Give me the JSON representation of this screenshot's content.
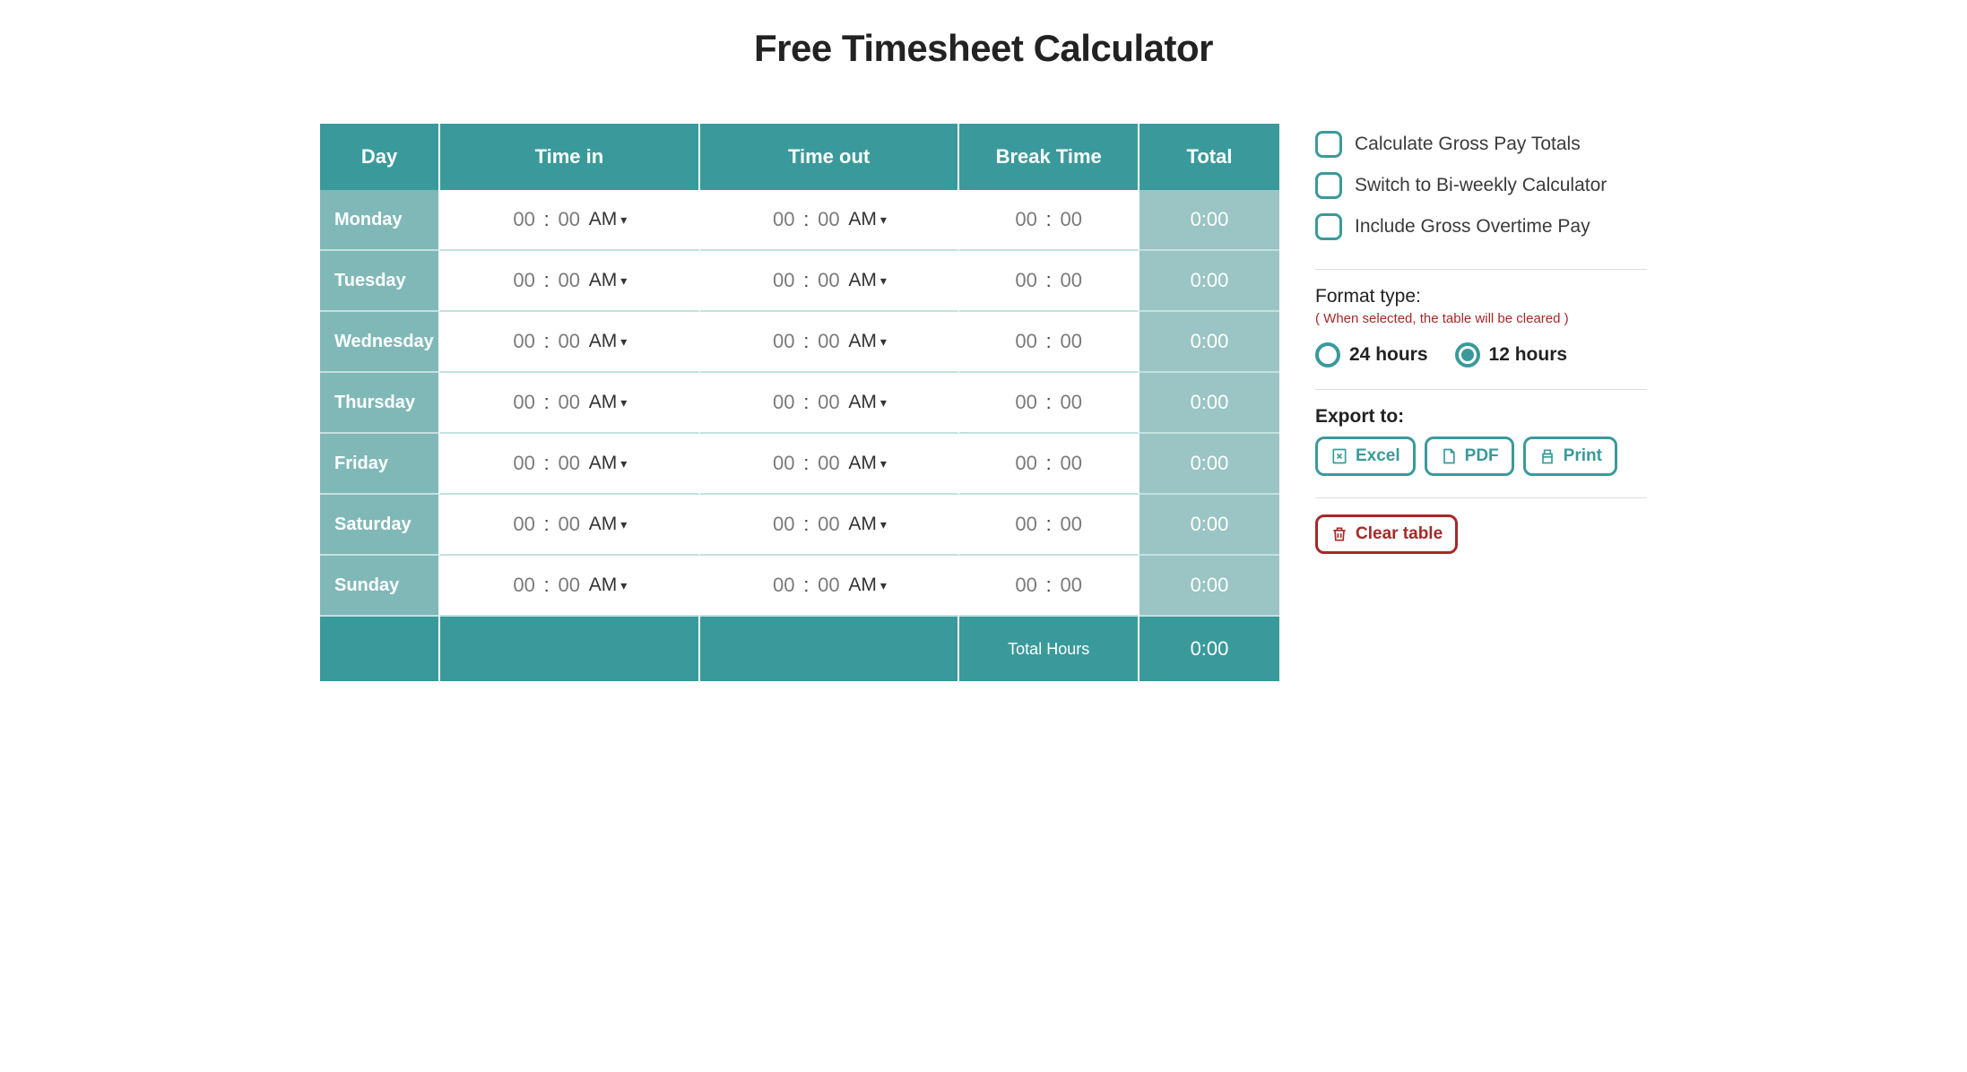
{
  "title": "Free Timesheet Calculator",
  "columns": [
    "Day",
    "Time in",
    "Time out",
    "Break Time",
    "Total"
  ],
  "days": [
    {
      "name": "Monday",
      "in_h": "00",
      "in_m": "00",
      "in_ap": "AM",
      "out_h": "00",
      "out_m": "00",
      "out_ap": "AM",
      "br_h": "00",
      "br_m": "00",
      "total": "0:00"
    },
    {
      "name": "Tuesday",
      "in_h": "00",
      "in_m": "00",
      "in_ap": "AM",
      "out_h": "00",
      "out_m": "00",
      "out_ap": "AM",
      "br_h": "00",
      "br_m": "00",
      "total": "0:00"
    },
    {
      "name": "Wednesday",
      "in_h": "00",
      "in_m": "00",
      "in_ap": "AM",
      "out_h": "00",
      "out_m": "00",
      "out_ap": "AM",
      "br_h": "00",
      "br_m": "00",
      "total": "0:00"
    },
    {
      "name": "Thursday",
      "in_h": "00",
      "in_m": "00",
      "in_ap": "AM",
      "out_h": "00",
      "out_m": "00",
      "out_ap": "AM",
      "br_h": "00",
      "br_m": "00",
      "total": "0:00"
    },
    {
      "name": "Friday",
      "in_h": "00",
      "in_m": "00",
      "in_ap": "AM",
      "out_h": "00",
      "out_m": "00",
      "out_ap": "AM",
      "br_h": "00",
      "br_m": "00",
      "total": "0:00"
    },
    {
      "name": "Saturday",
      "in_h": "00",
      "in_m": "00",
      "in_ap": "AM",
      "out_h": "00",
      "out_m": "00",
      "out_ap": "AM",
      "br_h": "00",
      "br_m": "00",
      "total": "0:00"
    },
    {
      "name": "Sunday",
      "in_h": "00",
      "in_m": "00",
      "in_ap": "AM",
      "out_h": "00",
      "out_m": "00",
      "out_ap": "AM",
      "br_h": "00",
      "br_m": "00",
      "total": "0:00"
    }
  ],
  "footer": {
    "label": "Total Hours",
    "value": "0:00"
  },
  "options": {
    "gross_pay": "Calculate Gross Pay Totals",
    "biweekly": "Switch to Bi-weekly Calculator",
    "overtime": "Include Gross Overtime Pay"
  },
  "format": {
    "title": "Format type:",
    "note": "( When selected, the table will be cleared )",
    "opt24": "24 hours",
    "opt12": "12 hours",
    "selected": "12"
  },
  "export": {
    "title": "Export to:",
    "excel": "Excel",
    "pdf": "PDF",
    "print": "Print"
  },
  "clear_label": "Clear table"
}
